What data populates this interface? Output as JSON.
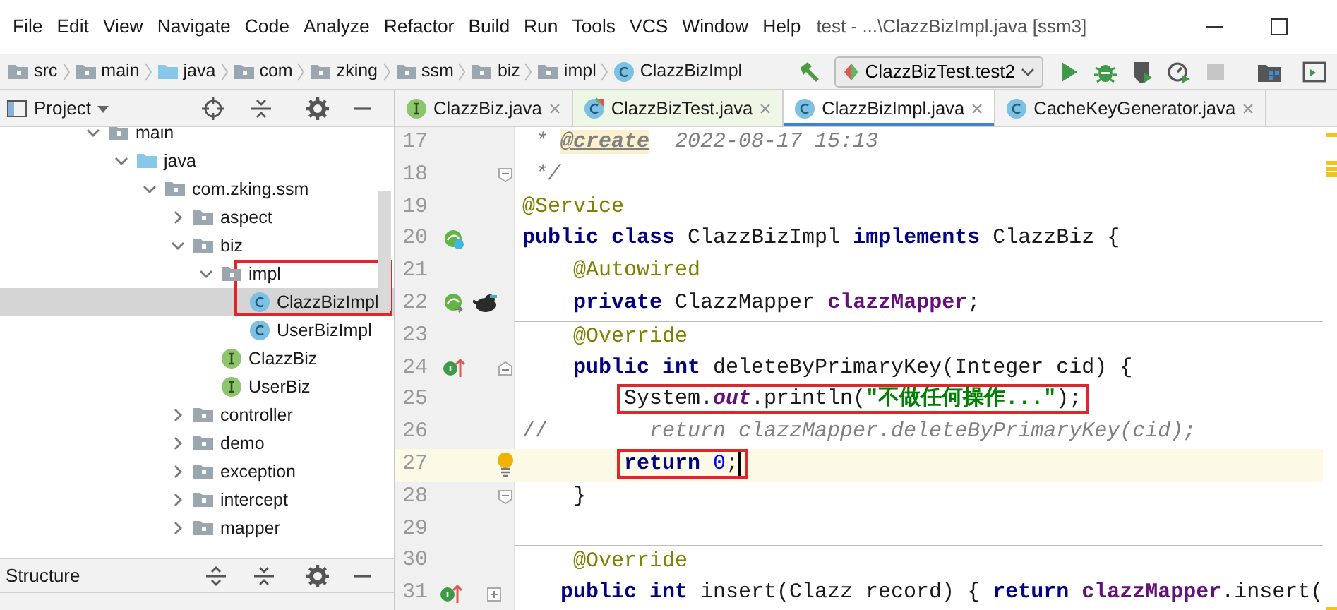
{
  "menu": [
    {
      "label": "File"
    },
    {
      "label": "Edit"
    },
    {
      "label": "View"
    },
    {
      "label": "Navigate"
    },
    {
      "label": "Code"
    },
    {
      "label": "Analyze"
    },
    {
      "label": "Refactor"
    },
    {
      "label": "Build"
    },
    {
      "label": "Run"
    },
    {
      "label": "Tools"
    },
    {
      "label": "VCS"
    },
    {
      "label": "Window"
    },
    {
      "label": "Help"
    }
  ],
  "window": {
    "title": "test - ...\\ClazzBizImpl.java [ssm3]"
  },
  "breadcrumbs": [
    {
      "label": "src",
      "kind": "folder"
    },
    {
      "label": "main",
      "kind": "folder"
    },
    {
      "label": "java",
      "kind": "source-folder"
    },
    {
      "label": "com",
      "kind": "package"
    },
    {
      "label": "zking",
      "kind": "package"
    },
    {
      "label": "ssm",
      "kind": "package"
    },
    {
      "label": "biz",
      "kind": "package"
    },
    {
      "label": "impl",
      "kind": "package"
    },
    {
      "label": "ClazzBizImpl",
      "kind": "class"
    }
  ],
  "run_config": {
    "label": "ClazzBizTest.test2"
  },
  "project_panel": {
    "title": "Project",
    "tree": [
      {
        "label": "main",
        "kind": "folder",
        "expanded": true,
        "selected": false,
        "framed": false,
        "children": [
          {
            "label": "java",
            "kind": "source-folder",
            "expanded": true,
            "selected": false,
            "framed": false,
            "children": [
              {
                "label": "com.zking.ssm",
                "kind": "package",
                "expanded": true,
                "selected": false,
                "framed": false,
                "children": [
                  {
                    "label": "aspect",
                    "kind": "package",
                    "expanded": false,
                    "selected": false,
                    "framed": false
                  },
                  {
                    "label": "biz",
                    "kind": "package",
                    "expanded": true,
                    "selected": false,
                    "framed": false,
                    "children": [
                      {
                        "label": "impl",
                        "kind": "package",
                        "expanded": true,
                        "selected": false,
                        "framed": true,
                        "children": [
                          {
                            "label": "ClazzBizImpl",
                            "kind": "class",
                            "selected": true,
                            "framed": true
                          },
                          {
                            "label": "UserBizImpl",
                            "kind": "class",
                            "selected": false,
                            "framed": false
                          }
                        ]
                      },
                      {
                        "label": "ClazzBiz",
                        "kind": "interface",
                        "selected": false,
                        "framed": false
                      },
                      {
                        "label": "UserBiz",
                        "kind": "interface",
                        "selected": false,
                        "framed": false
                      }
                    ]
                  },
                  {
                    "label": "controller",
                    "kind": "package",
                    "expanded": false,
                    "selected": false,
                    "framed": false
                  },
                  {
                    "label": "demo",
                    "kind": "package",
                    "expanded": false,
                    "selected": false,
                    "framed": false
                  },
                  {
                    "label": "exception",
                    "kind": "package",
                    "expanded": false,
                    "selected": false,
                    "framed": false
                  },
                  {
                    "label": "intercept",
                    "kind": "package",
                    "expanded": false,
                    "selected": false,
                    "framed": false
                  },
                  {
                    "label": "mapper",
                    "kind": "package",
                    "expanded": false,
                    "selected": false,
                    "framed": false
                  }
                ]
              }
            ]
          }
        ]
      }
    ]
  },
  "structure_panel": {
    "title": "Structure"
  },
  "tabs": [
    {
      "label": "ClazzBiz.java",
      "kind": "interface",
      "selected": false
    },
    {
      "label": "ClazzBizTest.java",
      "kind": "test-class",
      "selected": false
    },
    {
      "label": "ClazzBizImpl.java",
      "kind": "class",
      "selected": true
    },
    {
      "label": "CacheKeyGenerator.java",
      "kind": "class",
      "selected": false
    }
  ],
  "code": [
    {
      "number": "17",
      "current": false,
      "boxed": false,
      "separator": false,
      "tokens": [
        {
          "kind": "comment",
          "text": " * "
        },
        {
          "kind": "doc-tag",
          "text": "@create"
        },
        {
          "kind": "comment",
          "text": "  2022-08-17 15:13"
        }
      ]
    },
    {
      "number": "18",
      "marker": {
        "kind": "fold-end"
      },
      "current": false,
      "boxed": false,
      "separator": false,
      "tokens": [
        {
          "kind": "comment",
          "text": " */"
        }
      ]
    },
    {
      "number": "19",
      "current": false,
      "boxed": false,
      "separator": false,
      "tokens": [
        {
          "kind": "annotation",
          "text": "@Service"
        }
      ]
    },
    {
      "number": "20",
      "gutter": [
        {
          "kind": "bean"
        }
      ],
      "current": false,
      "boxed": false,
      "separator": false,
      "tokens": [
        {
          "kind": "keyword",
          "text": "public class"
        },
        {
          "kind": "plain",
          "text": " ClazzBizImpl "
        },
        {
          "kind": "keyword",
          "text": "implements"
        },
        {
          "kind": "plain",
          "text": " ClazzBiz {"
        }
      ]
    },
    {
      "number": "21",
      "current": false,
      "boxed": false,
      "separator": false,
      "tokens": [
        {
          "kind": "annotation",
          "text": "    @Autowired"
        }
      ]
    },
    {
      "number": "22",
      "gutter": [
        {
          "kind": "autowire"
        },
        {
          "kind": "mascot"
        }
      ],
      "current": false,
      "boxed": false,
      "separator": false,
      "tokens": [
        {
          "kind": "keyword",
          "text": "    private"
        },
        {
          "kind": "plain",
          "text": " ClazzMapper "
        },
        {
          "kind": "field",
          "text": "clazzMapper"
        },
        {
          "kind": "plain",
          "text": ";"
        }
      ]
    },
    {
      "number": "23",
      "current": false,
      "boxed": false,
      "separator": true,
      "tokens": [
        {
          "kind": "annotation",
          "text": "    @Override"
        }
      ]
    },
    {
      "number": "24",
      "gutter": [
        {
          "kind": "override"
        }
      ],
      "marker": {
        "kind": "fold-start"
      },
      "current": false,
      "boxed": false,
      "separator": false,
      "tokens": [
        {
          "kind": "keyword",
          "text": "    public int"
        },
        {
          "kind": "plain",
          "text": " deleteByPrimaryKey(Integer cid) {"
        }
      ]
    },
    {
      "number": "25",
      "current": false,
      "boxed": true,
      "separator": false,
      "tokens": [
        {
          "kind": "plain",
          "text": "        System."
        },
        {
          "kind": "static-field",
          "text": "out"
        },
        {
          "kind": "plain",
          "text": ".println("
        },
        {
          "kind": "string",
          "text": "\"不做任何操作...\""
        },
        {
          "kind": "plain",
          "text": ");"
        }
      ]
    },
    {
      "number": "26",
      "current": false,
      "boxed": false,
      "separator": false,
      "tokens": [
        {
          "kind": "line-comment",
          "text": "//"
        },
        {
          "kind": "comment",
          "text": "        return clazzMapper.deleteByPrimaryKey(cid);"
        }
      ]
    },
    {
      "number": "27",
      "marker": {
        "kind": "bulb"
      },
      "current": true,
      "boxed": true,
      "separator": false,
      "tokens": [
        {
          "kind": "keyword",
          "text": "        return"
        },
        {
          "kind": "number",
          "text": " 0"
        },
        {
          "kind": "plain",
          "text": ";"
        }
      ]
    },
    {
      "number": "28",
      "marker": {
        "kind": "fold-end"
      },
      "current": false,
      "boxed": false,
      "separator": false,
      "tokens": [
        {
          "kind": "plain",
          "text": "    }"
        }
      ]
    },
    {
      "number": "29",
      "current": false,
      "separator": false
    },
    {
      "number": "30",
      "current": false,
      "boxed": false,
      "separator": true,
      "tokens": [
        {
          "kind": "annotation",
          "text": "    @Override"
        }
      ]
    },
    {
      "number": "31",
      "gutter": [
        {
          "kind": "override"
        }
      ],
      "marker": {
        "kind": "fold-collapsed"
      },
      "current": false,
      "boxed": false,
      "separator": false,
      "tokens": [
        {
          "kind": "keyword",
          "text": "    public int"
        },
        {
          "kind": "plain",
          "text": " insert(Clazz record) { "
        },
        {
          "kind": "keyword",
          "text": "return"
        },
        {
          "kind": "field",
          "text": " clazzMapper"
        },
        {
          "kind": "plain",
          "text": ".insert("
        }
      ]
    }
  ]
}
